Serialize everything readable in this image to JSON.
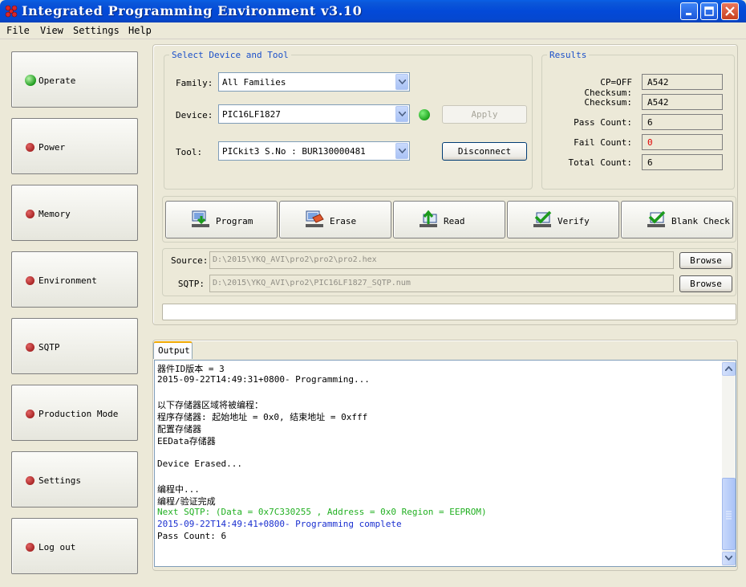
{
  "window": {
    "title": "Integrated Programming Environment v3.10"
  },
  "menu": [
    "File",
    "View",
    "Settings",
    "Help"
  ],
  "nav": [
    {
      "label": "Operate",
      "active": true
    },
    {
      "label": "Power",
      "active": false
    },
    {
      "label": "Memory",
      "active": false
    },
    {
      "label": "Environment",
      "active": false
    },
    {
      "label": "SQTP",
      "active": false
    },
    {
      "label": "Production Mode",
      "active": false
    },
    {
      "label": "Settings",
      "active": false
    },
    {
      "label": "Log out",
      "active": false
    }
  ],
  "device_group": {
    "title": "Select Device and Tool",
    "family_label": "Family:",
    "family_value": "All Families",
    "device_label": "Device:",
    "device_value": "PIC16LF1827",
    "tool_label": "Tool:",
    "tool_value": "PICkit3 S.No : BUR130000481",
    "apply_label": "Apply",
    "disconnect_label": "Disconnect",
    "status_color": "#1fa51f"
  },
  "results": {
    "title": "Results",
    "rows": [
      {
        "label": "CP=OFF Checksum:",
        "value": "A542",
        "color": "#000000"
      },
      {
        "label": "Checksum:",
        "value": "A542",
        "color": "#000000"
      },
      {
        "label": "Pass Count:",
        "value": "6",
        "color": "#000000"
      },
      {
        "label": "Fail Count:",
        "value": "0",
        "color": "#e00000"
      },
      {
        "label": "Total Count:",
        "value": "6",
        "color": "#000000"
      }
    ]
  },
  "actions": [
    {
      "label": "Program",
      "icon": "program-icon"
    },
    {
      "label": "Erase",
      "icon": "erase-icon"
    },
    {
      "label": "Read",
      "icon": "read-icon"
    },
    {
      "label": "Verify",
      "icon": "verify-icon"
    },
    {
      "label": "Blank Check",
      "icon": "blank-check-icon"
    }
  ],
  "files": {
    "source_label": "Source:",
    "source_value": "D:\\2015\\YKQ_AVI\\pro2\\pro2\\pro2.hex",
    "sqtp_label": "SQTP:",
    "sqtp_value": "D:\\2015\\YKQ_AVI\\pro2\\PIC16LF1827_SQTP.num",
    "browse_label": "Browse"
  },
  "output": {
    "tab_label": "Output",
    "lines": [
      {
        "text": "器件ID版本 = 3",
        "color": "#000000"
      },
      {
        "text": "2015-09-22T14:49:31+0800- Programming...",
        "color": "#000000"
      },
      {
        "text": "",
        "color": "#000000"
      },
      {
        "text": "以下存储器区域将被编程：",
        "color": "#000000"
      },
      {
        "text": "程序存储器: 起始地址 = 0x0, 结束地址 = 0xfff",
        "color": "#000000"
      },
      {
        "text": "配置存储器",
        "color": "#000000"
      },
      {
        "text": "EEData存储器",
        "color": "#000000"
      },
      {
        "text": "",
        "color": "#000000"
      },
      {
        "text": "Device Erased...",
        "color": "#000000"
      },
      {
        "text": "",
        "color": "#000000"
      },
      {
        "text": "编程中...",
        "color": "#000000"
      },
      {
        "text": "编程/验证完成",
        "color": "#000000"
      },
      {
        "text": "Next SQTP: (Data = 0x7C330255 , Address = 0x0 Region = EEPROM)",
        "color": "#22b022"
      },
      {
        "text": "2015-09-22T14:49:41+0800- Programming complete",
        "color": "#1a2fd0"
      },
      {
        "text": "Pass Count: 6",
        "color": "#000000"
      }
    ]
  }
}
